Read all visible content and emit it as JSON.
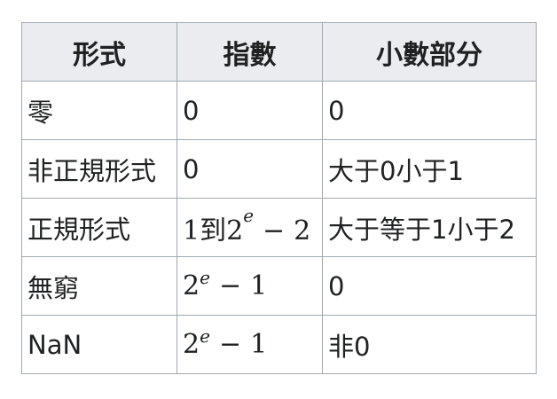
{
  "table": {
    "headers": [
      "形式",
      "指數",
      "小數部分"
    ],
    "rows": [
      {
        "form": "零",
        "exponent": {
          "type": "text",
          "text": "0"
        },
        "fraction": "0"
      },
      {
        "form": "非正規形式",
        "exponent": {
          "type": "text",
          "text": "0"
        },
        "fraction": "大于0小于1"
      },
      {
        "form": "正規形式",
        "exponent": {
          "type": "math",
          "prefix": "1到",
          "base": "2",
          "sup": "e",
          "op": "−",
          "operand": "2"
        },
        "fraction": "大于等于1小于2"
      },
      {
        "form": "無窮",
        "exponent": {
          "type": "math",
          "prefix": "",
          "base": "2",
          "sup": "e",
          "op": "−",
          "operand": "1"
        },
        "fraction": "0"
      },
      {
        "form": "NaN",
        "exponent": {
          "type": "math",
          "prefix": "",
          "base": "2",
          "sup": "e",
          "op": "−",
          "operand": "1"
        },
        "fraction": "非0"
      }
    ]
  }
}
